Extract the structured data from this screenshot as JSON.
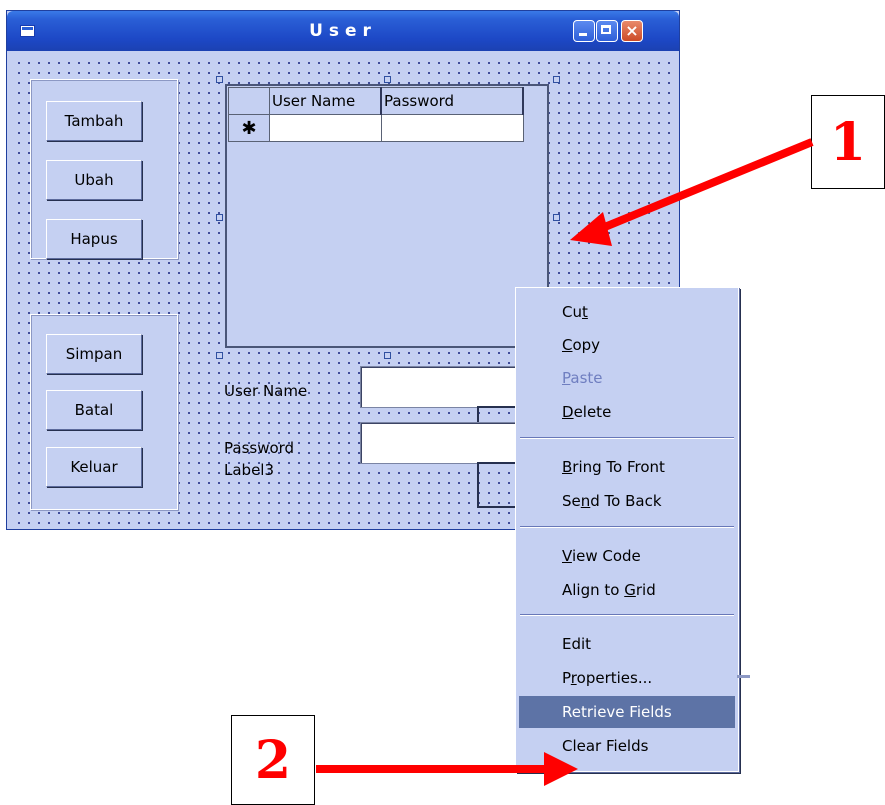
{
  "window": {
    "title": "User"
  },
  "frame_top": {
    "buttons": [
      "Tambah",
      "Ubah",
      "Hapus"
    ]
  },
  "frame_bottom": {
    "buttons": [
      "Simpan",
      "Batal",
      "Keluar"
    ]
  },
  "grid": {
    "columns": [
      "User Name",
      "Password"
    ],
    "new_row_marker": "✱"
  },
  "form": {
    "username_label": "User Name",
    "password_label": "Password",
    "label3": "Label3",
    "username_value": "",
    "password_value": ""
  },
  "context_menu": {
    "items": [
      {
        "label": "Cut",
        "mnemonic": "t",
        "enabled": true
      },
      {
        "label": "Copy",
        "mnemonic": "C",
        "enabled": true
      },
      {
        "label": "Paste",
        "mnemonic": "P",
        "enabled": false
      },
      {
        "label": "Delete",
        "mnemonic": "D",
        "enabled": true
      },
      {
        "label": "Bring To Front",
        "mnemonic": "B",
        "enabled": true
      },
      {
        "label": "Send To Back",
        "mnemonic": "n",
        "enabled": true
      },
      {
        "label": "View Code",
        "mnemonic": "V",
        "enabled": true
      },
      {
        "label": "Align to Grid",
        "mnemonic": "G",
        "enabled": true
      },
      {
        "label": "Edit",
        "mnemonic": "",
        "enabled": true
      },
      {
        "label": "Properties...",
        "mnemonic": "r",
        "enabled": true
      },
      {
        "label": "Retrieve Fields",
        "mnemonic": "",
        "enabled": true,
        "highlighted": true
      },
      {
        "label": "Clear Fields",
        "mnemonic": "",
        "enabled": true
      }
    ]
  },
  "callouts": {
    "one": "1",
    "two": "2"
  },
  "colors": {
    "titlebar": "#1d48c6",
    "form_background": "#c5d0f2",
    "menu_highlight": "#5d73a6",
    "arrow": "#ff0000"
  }
}
